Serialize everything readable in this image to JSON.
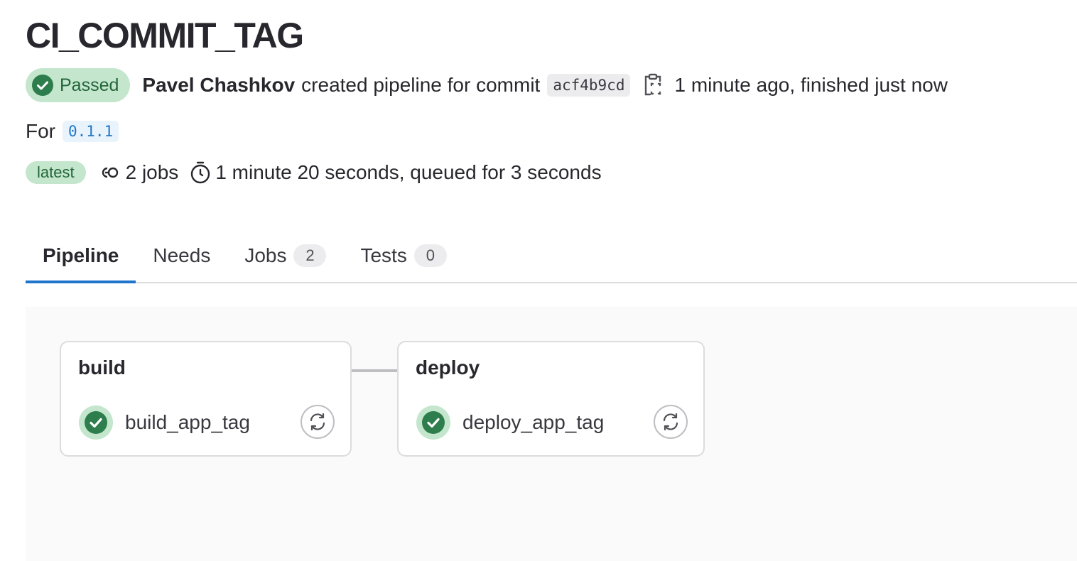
{
  "page": {
    "title": "CI_COMMIT_TAG"
  },
  "header": {
    "status": "Passed",
    "author": "Pavel Chashkov",
    "action": "created pipeline for commit",
    "sha": "acf4b9cd",
    "time": "1 minute ago, finished just now",
    "for_label": "For",
    "ref": "0.1.1",
    "badge": "latest",
    "jobs": "2 jobs",
    "duration": "1 minute 20 seconds, queued for 3 seconds"
  },
  "tabs": [
    {
      "label": "Pipeline",
      "active": true
    },
    {
      "label": "Needs"
    },
    {
      "label": "Jobs",
      "count": "2"
    },
    {
      "label": "Tests",
      "count": "0"
    }
  ],
  "stages": [
    {
      "name": "build",
      "jobs": [
        {
          "name": "build_app_tag",
          "status": "success"
        }
      ]
    },
    {
      "name": "deploy",
      "jobs": [
        {
          "name": "deploy_app_tag",
          "status": "success"
        }
      ]
    }
  ],
  "colors": {
    "success": "#2e7d4c",
    "success_bg": "#c3e6cd",
    "accent": "#1f75cb"
  },
  "icons": {
    "status": "status-success-icon",
    "copy": "copy-to-clipboard-icon",
    "jobs": "pipeline-jobs-icon",
    "timer": "stopwatch-icon",
    "retry": "retry-icon"
  }
}
